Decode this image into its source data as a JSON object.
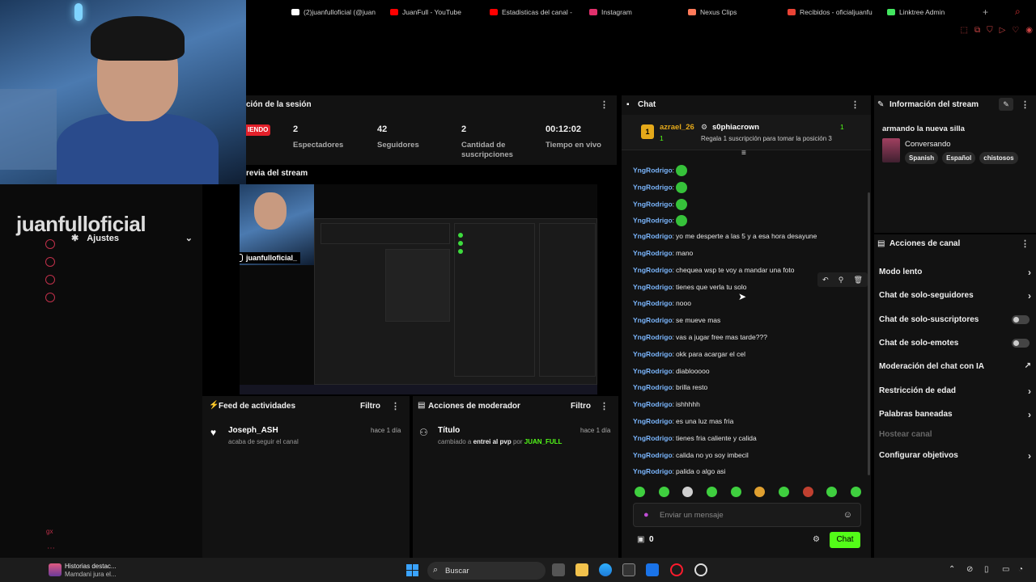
{
  "browser": {
    "tabs": [
      {
        "label": "(2)juanfulloficial (@juan",
        "color": "#ffffff"
      },
      {
        "label": "JuanFull - YouTube",
        "color": "#ff0000"
      },
      {
        "label": "Estadisticas del canal -",
        "color": "#ff0000"
      },
      {
        "label": "Instagram",
        "color": "#e1306c"
      },
      {
        "label": "Nexus Clips",
        "color": "#ff7a59"
      },
      {
        "label": "Recibidos - oficialjuanfu",
        "color": "#ea4335"
      },
      {
        "label": "Linktree Admin",
        "color": "#43e660"
      }
    ]
  },
  "left_sidebar": {
    "brand": "juanfulloficial",
    "ajustes_label": "Ajustes",
    "footer_text": "gx"
  },
  "session": {
    "title": "ción de la sesión",
    "live_badge": "IENDO",
    "stats": [
      {
        "value": "2",
        "label": "Espectadores"
      },
      {
        "value": "42",
        "label": "Seguidores"
      },
      {
        "value": "2",
        "label": "Cantidad de suscripciones"
      },
      {
        "value": "00:12:02",
        "label": "Tiempo en vivo"
      }
    ]
  },
  "preview": {
    "title": "revia del stream",
    "instagram_handle": "juanfulloficial_"
  },
  "activity_feed": {
    "title": "Feed de actividades",
    "filter_label": "Filtro",
    "items": [
      {
        "name": "Joseph_ASH",
        "detail": "acaba de seguir el canal",
        "time": "hace 1 día"
      }
    ]
  },
  "mod_actions": {
    "title": "Acciones de moderador",
    "filter_label": "Filtro",
    "items": [
      {
        "name": "Título",
        "prefix": "cambiado a",
        "value": "entrei al pvp",
        "by": "por",
        "mod": "JUAN_FULL",
        "time": "hace 1 día"
      }
    ]
  },
  "chat": {
    "title": "Chat",
    "pinned": {
      "rank": "1",
      "user": "azrael_26",
      "count": "1",
      "gifter": "s0phiacrown",
      "gift_count": "1",
      "message": "Regala 1 suscripción para tomar la posición 3"
    },
    "messages": [
      {
        "user": "YngRodrigo",
        "text": "",
        "emote": true
      },
      {
        "user": "YngRodrigo",
        "text": "",
        "emote": true
      },
      {
        "user": "YngRodrigo",
        "text": "",
        "emote": true
      },
      {
        "user": "YngRodrigo",
        "text": "",
        "emote": true
      },
      {
        "user": "YngRodrigo",
        "text": "yo me desperte a las 5 y a esa hora desayune",
        "emote": false
      },
      {
        "user": "YngRodrigo",
        "text": "mano",
        "emote": false
      },
      {
        "user": "YngRodrigo",
        "text": "chequea wsp te voy a mandar una foto",
        "emote": false
      },
      {
        "user": "YngRodrigo",
        "text": "tienes que verla tu solo",
        "emote": false
      },
      {
        "user": "YngRodrigo",
        "text": "nooo",
        "emote": false
      },
      {
        "user": "YngRodrigo",
        "text": "se mueve mas",
        "emote": false
      },
      {
        "user": "YngRodrigo",
        "text": "vas a jugar free mas tarde???",
        "emote": false
      },
      {
        "user": "YngRodrigo",
        "text": "okk para acargar el cel",
        "emote": false
      },
      {
        "user": "YngRodrigo",
        "text": "diablooooo",
        "emote": false
      },
      {
        "user": "YngRodrigo",
        "text": "brilla resto",
        "emote": false
      },
      {
        "user": "YngRodrigo",
        "text": "ishhhhh",
        "emote": false
      },
      {
        "user": "YngRodrigo",
        "text": "es una luz mas fria",
        "emote": false
      },
      {
        "user": "YngRodrigo",
        "text": "tienes fria caliente y calida",
        "emote": false
      },
      {
        "user": "YngRodrigo",
        "text": "calida no yo soy imbecil",
        "emote": false
      },
      {
        "user": "YngRodrigo",
        "text": "palida o algo asi",
        "emote": false
      }
    ],
    "input_placeholder": "Enviar un mensaje",
    "points": "0",
    "send_label": "Chat"
  },
  "stream_info": {
    "title": "Información del stream",
    "stream_title": "armando la nueva silla",
    "category": "Conversando",
    "tags": [
      "Spanish",
      "Español",
      "chistosos"
    ]
  },
  "channel_actions": {
    "title": "Acciones de canal",
    "items": [
      {
        "label": "Modo lento",
        "control": "arrow"
      },
      {
        "label": "Chat de solo-seguidores",
        "control": "arrow"
      },
      {
        "label": "Chat de solo-suscriptores",
        "control": "toggle"
      },
      {
        "label": "Chat de solo-emotes",
        "control": "toggle"
      },
      {
        "label": "Moderación del chat con IA",
        "control": "external"
      },
      {
        "label": "Restricción de edad",
        "control": "arrow"
      },
      {
        "label": "Palabras baneadas",
        "control": "arrow"
      },
      {
        "label": "Hostear canal",
        "control": "none"
      },
      {
        "label": "Configurar objetivos",
        "control": "arrow"
      }
    ]
  },
  "taskbar": {
    "notification_title": "Historias destac...",
    "notification_sub": "Mamdani jura el...",
    "search_placeholder": "Buscar"
  }
}
